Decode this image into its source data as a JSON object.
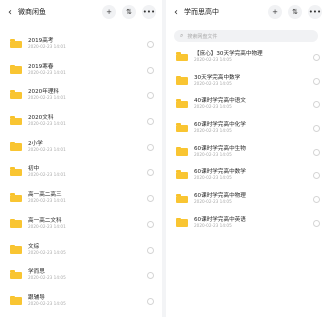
{
  "left": {
    "title": "微商闲鱼",
    "items": [
      {
        "name": "2019高考",
        "date": "2020-02-23 14:01"
      },
      {
        "name": "2019寒春",
        "date": "2020-02-23 14:01"
      },
      {
        "name": "2020年理科",
        "date": "2020-02-23 14:01"
      },
      {
        "name": "2020文科",
        "date": "2020-02-23 14:01"
      },
      {
        "name": "2小学",
        "date": "2020-02-23 14:01"
      },
      {
        "name": "初中",
        "date": "2020-02-23 14:01"
      },
      {
        "name": "高一高二高三",
        "date": "2020-02-23 14:01"
      },
      {
        "name": "高一高二文科",
        "date": "2020-02-23 14:01"
      },
      {
        "name": "文综",
        "date": "2020-02-23 14:05"
      },
      {
        "name": "学而思",
        "date": "2020-02-23 14:05"
      },
      {
        "name": "跟辅导",
        "date": "2020-02-23 14:05"
      }
    ]
  },
  "right": {
    "title": "学而思高中",
    "search_placeholder": "搜索网盘文件",
    "items": [
      {
        "name": "【庶心】30天学完高中物理",
        "date": "2020-02-23 14:05"
      },
      {
        "name": "30天学完高中数学",
        "date": "2020-02-23 14:05"
      },
      {
        "name": "40课时学完高中语文",
        "date": "2020-02-23 14:05"
      },
      {
        "name": "60课时学完高中化学",
        "date": "2020-02-23 14:05"
      },
      {
        "name": "60课时学完高中生物",
        "date": "2020-02-23 14:05"
      },
      {
        "name": "60课时学完高中数学",
        "date": "2020-02-23 14:05"
      },
      {
        "name": "60课时学完高中物理",
        "date": "2020-02-23 14:05"
      },
      {
        "name": "60课时学完高中英语",
        "date": "2020-02-23 14:05"
      }
    ]
  },
  "icons": {
    "back": "‹",
    "add": "+",
    "sort": "⇅",
    "more": "•••",
    "search": "⌕"
  },
  "colors": {
    "folder": "#f9c532",
    "accent": "#f8c22a"
  }
}
